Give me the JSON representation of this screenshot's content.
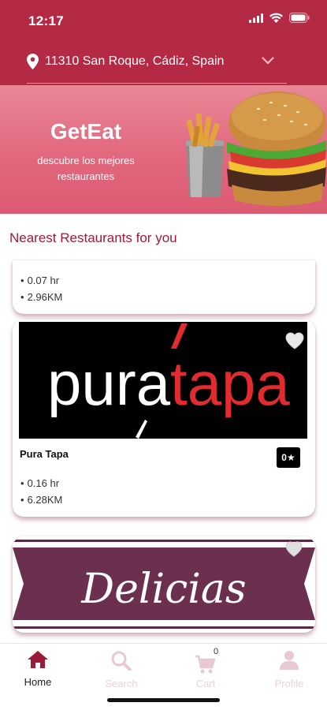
{
  "status_bar": {
    "time": "12:17"
  },
  "location": {
    "address": "11310 San Roque, Cádiz, Spain"
  },
  "banner": {
    "brand": "GetEat",
    "tagline": "descubre los mejores restaurantes"
  },
  "section_title": "Nearest Restaurants for you",
  "restaurants": [
    {
      "time": "0.07 hr",
      "distance": "2.96KM"
    },
    {
      "name": "Pura Tapa",
      "logo_text_1": "pura",
      "logo_text_2": "tapa",
      "rating": "0★",
      "time": "0.16 hr",
      "distance": "6.28KM"
    },
    {
      "logo_text": "Delicias"
    }
  ],
  "bullet": "•",
  "nav": {
    "home": "Home",
    "search": "Search",
    "cart": "Cart",
    "cart_count": "0",
    "profile": "Profile"
  },
  "colors": {
    "header": "#b42a44",
    "accent": "#9c1c38",
    "banner": "#e2687e",
    "nav_inactive": "#e8d3d8"
  }
}
